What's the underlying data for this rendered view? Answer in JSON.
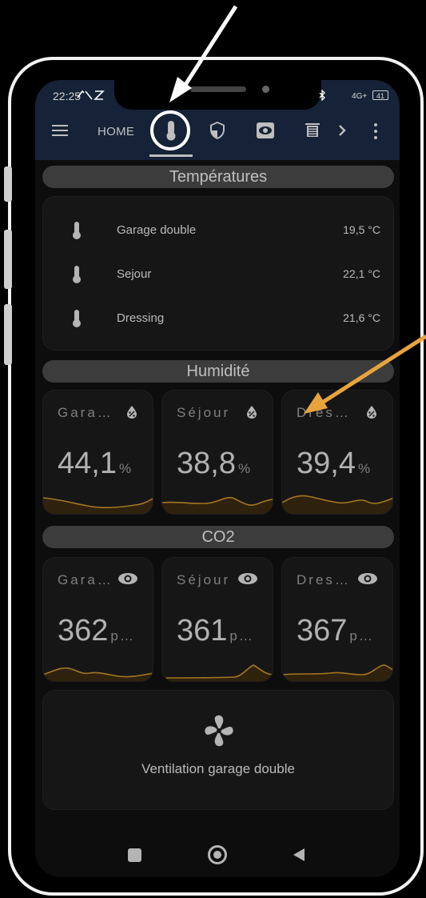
{
  "status": {
    "time": "22:25",
    "signal": "4G+",
    "battery": "41"
  },
  "topbar": {
    "home_label": "HOME",
    "tabs": [
      {
        "icon": "thermometer-icon",
        "active": true
      },
      {
        "icon": "shield-icon",
        "active": false
      },
      {
        "icon": "eye-box-icon",
        "active": false
      },
      {
        "icon": "blinds-icon",
        "active": false
      }
    ],
    "more_icon": "chevron-right-icon"
  },
  "temperatures": {
    "header": "Températures",
    "rows": [
      {
        "name": "Garage double",
        "value": "19,5 °C"
      },
      {
        "name": "Sejour",
        "value": "22,1 °C"
      },
      {
        "name": "Dressing",
        "value": "21,6 °C"
      }
    ]
  },
  "humidity": {
    "header": "Humidité",
    "tiles": [
      {
        "title": "Gara…",
        "value": "44,1",
        "unit": "%"
      },
      {
        "title": "Séjour",
        "value": "38,8",
        "unit": "%"
      },
      {
        "title": "Dres…",
        "value": "39,4",
        "unit": "%"
      }
    ]
  },
  "co2": {
    "header": "CO2",
    "tiles": [
      {
        "title": "Gara…",
        "value": "362",
        "unit": "p…"
      },
      {
        "title": "Séjour",
        "value": "361",
        "unit": "p…"
      },
      {
        "title": "Dres…",
        "value": "367",
        "unit": "p…"
      }
    ]
  },
  "ventilation": {
    "label": "Ventilation garage double",
    "icon": "fan-icon"
  },
  "colors": {
    "appbar": "#1a2a44",
    "sparkline": "#c8902a",
    "annotation_arrow": "#e8a33d"
  }
}
